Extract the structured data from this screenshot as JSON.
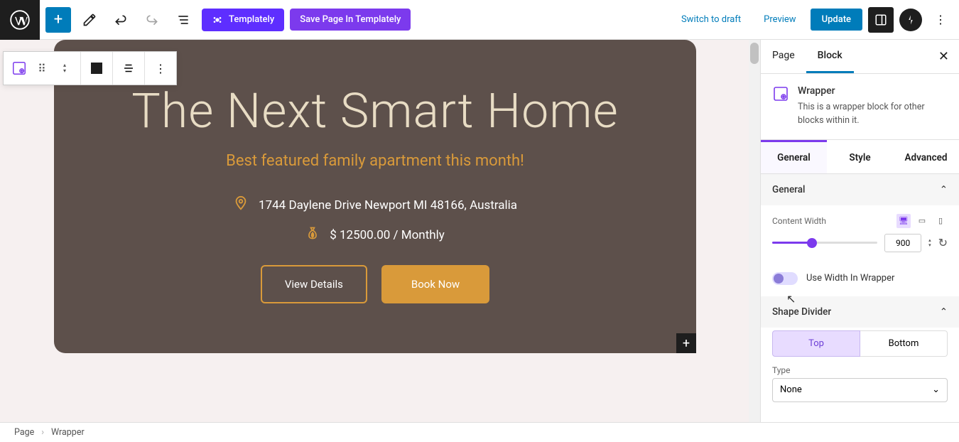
{
  "toolbar": {
    "templately_label": "Templately",
    "save_templately_label": "Save Page In Templately",
    "switch_draft": "Switch to draft",
    "preview": "Preview",
    "update": "Update"
  },
  "hero": {
    "title": "The Next Smart Home",
    "subtitle": "Best featured family apartment this month!",
    "address": "1744 Daylene Drive Newport MI 48166, Australia",
    "price": "$ 12500.00 / Monthly",
    "btn_details": "View Details",
    "btn_book": "Book Now"
  },
  "sidebar": {
    "tabs": {
      "page": "Page",
      "block": "Block"
    },
    "block_title": "Wrapper",
    "block_desc": "This is a wrapper block for other blocks within it.",
    "subtabs": {
      "general": "General",
      "style": "Style",
      "advanced": "Advanced"
    },
    "panel_general": "General",
    "content_width_label": "Content Width",
    "content_width_value": "900",
    "use_width_label": "Use Width In Wrapper",
    "panel_shape": "Shape Divider",
    "seg_top": "Top",
    "seg_bottom": "Bottom",
    "type_label": "Type",
    "type_value": "None"
  },
  "breadcrumb": {
    "page": "Page",
    "current": "Wrapper"
  }
}
